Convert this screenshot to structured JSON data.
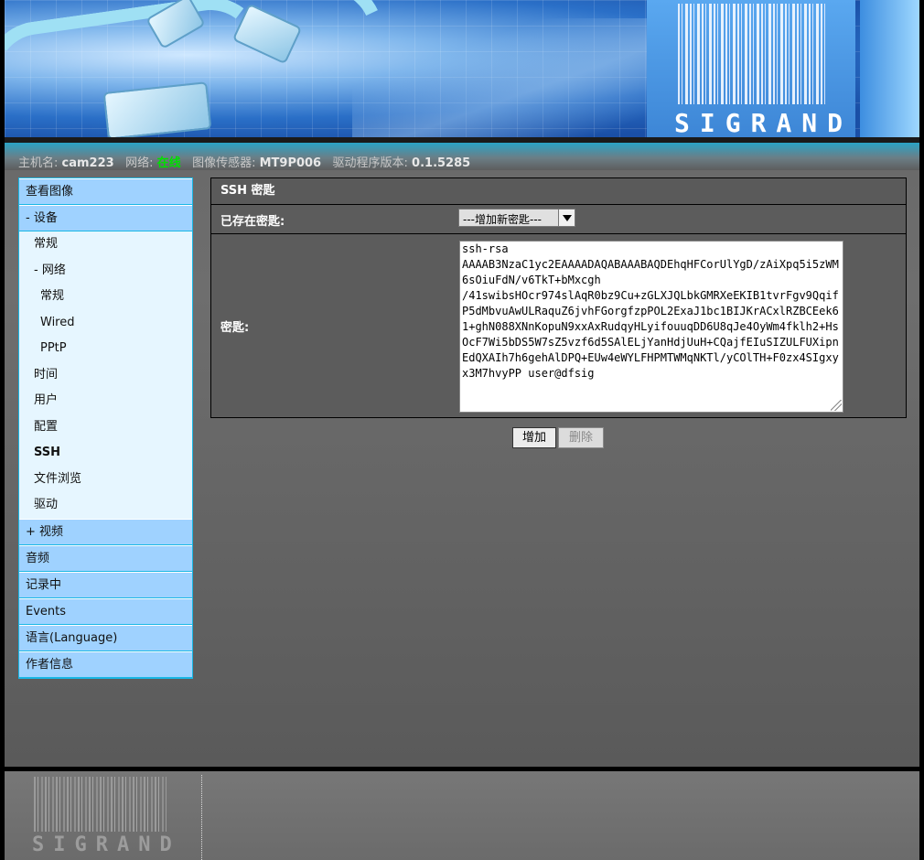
{
  "brand": {
    "logo_text": "SIGRAND"
  },
  "status": {
    "hostname_label": "主机名:",
    "hostname": "cam223",
    "network_label": "网络:",
    "network_state": "在线",
    "sensor_label": "图像传感器:",
    "sensor": "MT9P006",
    "driver_label": "驱动程序版本:",
    "driver_version": "0.1.5285"
  },
  "sidebar": {
    "view_image": "查看图像",
    "device": "- 设备",
    "general": "常规",
    "network": "- 网络",
    "net_general": "常规",
    "net_wired": "Wired",
    "net_pptp": "PPtP",
    "time": "时间",
    "users": "用户",
    "config": "配置",
    "ssh": "SSH",
    "file_browse": "文件浏览",
    "drivers": "驱动",
    "video": "+ 视频",
    "audio": "音频",
    "recording": "记录中",
    "events": "Events",
    "language": "语言(Language)",
    "about": "作者信息"
  },
  "panel": {
    "title": "SSH 密匙",
    "existing_label": "已存在密匙:",
    "existing_selected": "---增加新密匙---",
    "key_label": "密匙:",
    "key_value": "ssh-rsa\nAAAAB3NzaC1yc2EAAAADAQABAAABAQDEhqHFCorUlYgD/zAiXpq5i5zWM6sOiuFdN/v6TkT+bMxcgh\n/41swibsHOcr974slAqR0bz9Cu+zGLXJQLbkGMRXeEKIB1tvrFgv9QqifP5dMbvuAwULRaquZ6jvhFGorgfzpPOL2ExaJ1bc1BIJKrACxlRZBCEek61+ghN088XNnKopuN9xxAxRudqyHLyifouuqDD6U8qJe4OyWm4fklh2+HsOcF7Wi5bDS5W7sZ5vzf6d5SAlELjYanHdjUuH+CQajfEIuSIZULFUXipnEdQXAIh7h6gehAlDPQ+EUw4eWYLFHPMTWMqNKTl/yCOlTH+F0zx4SIgxyx3M7hvyPP user@dfsig"
  },
  "actions": {
    "add": "增加",
    "delete": "删除"
  }
}
